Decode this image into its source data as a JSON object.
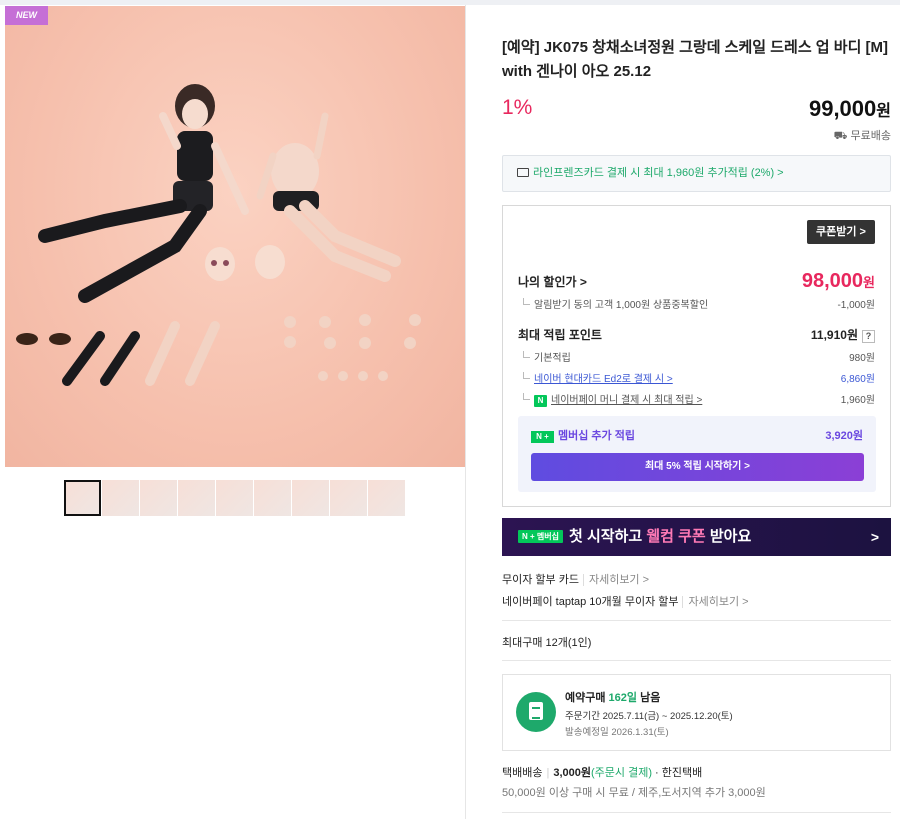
{
  "product": {
    "badge": "NEW",
    "title": "[예약] JK075 창채소녀정원 그랑데 스케일 드레스 업 바디 [M] with 겐나이 아오 25.12",
    "discount": "1%",
    "price": "99,000",
    "price_unit": "원",
    "shipping_label": "무료배송"
  },
  "card_promo": "라인프렌즈카드 결제 시 최대 1,960원 추가적립 (2%) >",
  "benefit": {
    "coupon_button": "쿠폰받기 >",
    "my_discount_label": "나의 할인가 >",
    "my_discount_price": "98,000",
    "my_discount_unit": "원",
    "alert_discount_label": "알림받기 동의 고객 1,000원 상품중복할인",
    "alert_discount_value": "-1,000원",
    "max_points_label": "최대 적립 포인트",
    "max_points_value": "11,910원",
    "help": "?",
    "basic_points_label": "기본적립",
    "basic_points_value": "980원",
    "hyundai_label": "네이버 현대카드 Ed2로 결제 시 >",
    "hyundai_value": "6,860원",
    "npay_icon": "N",
    "npay_money_label": "네이버페이 머니 결제 시 최대 적립 >",
    "npay_money_value": "1,960원",
    "membership_icon": "N +",
    "membership_label": "멤버십 추가 적립",
    "membership_value": "3,920원",
    "membership_button": "최대 5% 적립 시작하기 >"
  },
  "banner": {
    "icon": "N + 멤버십",
    "text_before": "첫 시작하고 ",
    "highlight": "웰컴 쿠폰",
    "text_after": " 받아요",
    "chevron": ">"
  },
  "installment": {
    "card_label": "무이자 할부 카드",
    "card_more": "자세히보기 >",
    "npay_label": "네이버페이 taptap 10개월 무이자 할부",
    "npay_more": "자세히보기 >"
  },
  "max_purchase": "최대구매 12개(1인)",
  "preorder": {
    "title_prefix": "예약구매 ",
    "days": "162일",
    "title_suffix": " 남음",
    "order_period": "주문기간   2025.7.11(금) ~ 2025.12.20(토)",
    "ship_date": "발송예정일   2026.1.31(토)"
  },
  "delivery": {
    "type": "택배배송",
    "fee": "3,000원",
    "fee_note": "(주문시 결제)",
    "carrier": "· 한진택배",
    "condition": "50,000원 이상 구매 시 무료 / 제주,도서지역 추가 3,000원"
  },
  "colors": {
    "accent_red": "#e8285e",
    "naver_green": "#03c75a",
    "membership_purple": "#6a47e0"
  }
}
